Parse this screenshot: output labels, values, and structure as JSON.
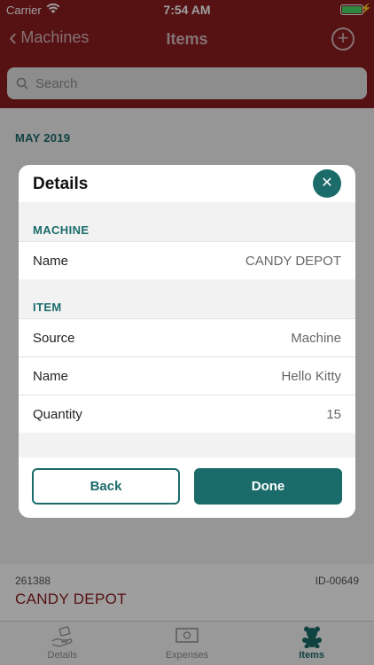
{
  "status_bar": {
    "carrier": "Carrier",
    "time": "7:54 AM"
  },
  "nav": {
    "back_label": "Machines",
    "title": "Items"
  },
  "search": {
    "placeholder": "Search"
  },
  "list": {
    "section_header": "MAY 2019",
    "bottom_card": {
      "code": "261388",
      "id": "ID-00649",
      "name": "CANDY DEPOT"
    }
  },
  "modal": {
    "title": "Details",
    "machine_header": "MACHINE",
    "machine_rows": [
      {
        "label": "Name",
        "value": "CANDY DEPOT"
      }
    ],
    "item_header": "ITEM",
    "item_rows": [
      {
        "label": "Source",
        "value": "Machine"
      },
      {
        "label": "Name",
        "value": "Hello Kitty"
      },
      {
        "label": "Quantity",
        "value": "15"
      }
    ],
    "back_label": "Back",
    "done_label": "Done"
  },
  "tabs": [
    {
      "label": "Details",
      "icon": "hand-money-icon"
    },
    {
      "label": "Expenses",
      "icon": "cash-icon"
    },
    {
      "label": "Items",
      "icon": "teddy-bear-icon"
    }
  ],
  "colors": {
    "brand": "#8c1c20",
    "accent": "#1b6b6a"
  }
}
